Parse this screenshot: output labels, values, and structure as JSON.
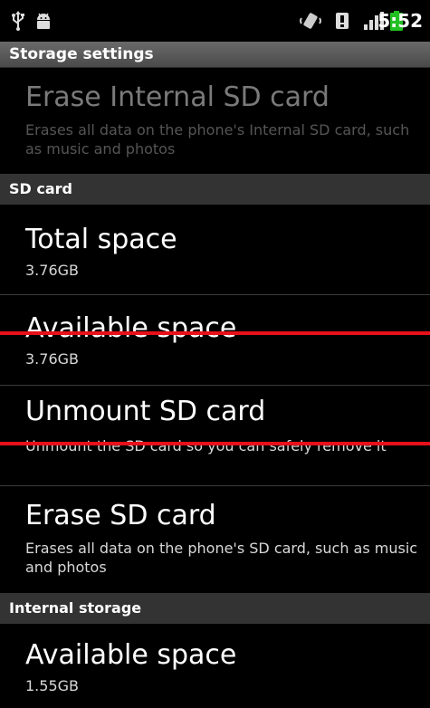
{
  "status_bar": {
    "time": "5:52",
    "icons": [
      "usb-icon",
      "android-debug-icon",
      "vibrate-icon",
      "alert-icon",
      "signal-icon",
      "battery-icon"
    ],
    "battery_color": "#22c022"
  },
  "title": "Storage settings",
  "sections": [
    {
      "header": "",
      "items": [
        {
          "title": "Erase Internal SD card",
          "summary": "Erases all data on the phone's Internal SD card, such as music and photos",
          "enabled": false
        }
      ]
    },
    {
      "header": "SD card",
      "items": [
        {
          "title": "Total space",
          "summary": "3.76GB",
          "enabled": true
        },
        {
          "title": "Available space",
          "summary": "3.76GB",
          "enabled": true
        },
        {
          "title": "Unmount SD card",
          "summary": "Unmount the SD card so you can safely remove it",
          "enabled": true
        },
        {
          "title": "Erase SD card",
          "summary": "Erases all data on the phone's SD card, such as music and photos",
          "enabled": true
        }
      ]
    },
    {
      "header": "Internal storage",
      "items": [
        {
          "title": "Available space",
          "summary": "1.55GB",
          "enabled": true
        }
      ]
    }
  ],
  "colors": {
    "overlay_line": "#e8101a",
    "category_bg": "#333333",
    "disabled_text": "#7a7a7a"
  }
}
